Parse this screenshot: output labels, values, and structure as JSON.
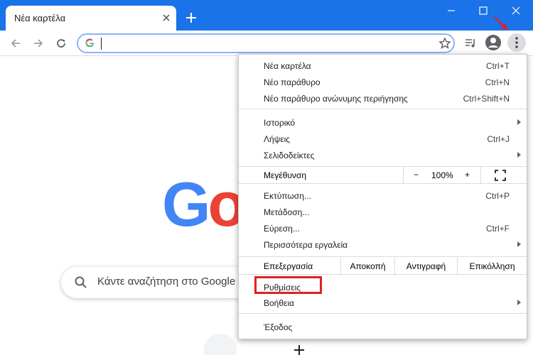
{
  "tab": {
    "title": "Νέα καρτέλα"
  },
  "omnibox": {
    "value": "",
    "placeholder": ""
  },
  "page": {
    "search_placeholder": "Κάντε αναζήτηση στο Google"
  },
  "colors": {
    "chrome_blue": "#1a73e8",
    "highlight_red": "#e02020"
  },
  "menu": {
    "group1": [
      {
        "label": "Νέα καρτέλα",
        "shortcut": "Ctrl+T"
      },
      {
        "label": "Νέο παράθυρο",
        "shortcut": "Ctrl+N"
      },
      {
        "label": "Νέο παράθυρο ανώνυμης περιήγησης",
        "shortcut": "Ctrl+Shift+N"
      }
    ],
    "group2": [
      {
        "label": "Ιστορικό",
        "shortcut": ""
      },
      {
        "label": "Λήψεις",
        "shortcut": "Ctrl+J"
      },
      {
        "label": "Σελιδοδείκτες",
        "shortcut": ""
      }
    ],
    "zoom": {
      "label": "Μεγέθυνση",
      "minus": "−",
      "value": "100%",
      "plus": "+"
    },
    "group3": [
      {
        "label": "Εκτύπωση...",
        "shortcut": "Ctrl+P"
      },
      {
        "label": "Μετάδοση...",
        "shortcut": ""
      },
      {
        "label": "Εύρεση...",
        "shortcut": "Ctrl+F"
      },
      {
        "label": "Περισσότερα εργαλεία",
        "shortcut": ""
      }
    ],
    "edit": {
      "label": "Επεξεργασία",
      "cut": "Αποκοπή",
      "copy": "Αντιγραφή",
      "paste": "Επικόλληση"
    },
    "settings": "Ρυθμίσεις",
    "help": "Βοήθεια",
    "exit": "Έξοδος"
  }
}
